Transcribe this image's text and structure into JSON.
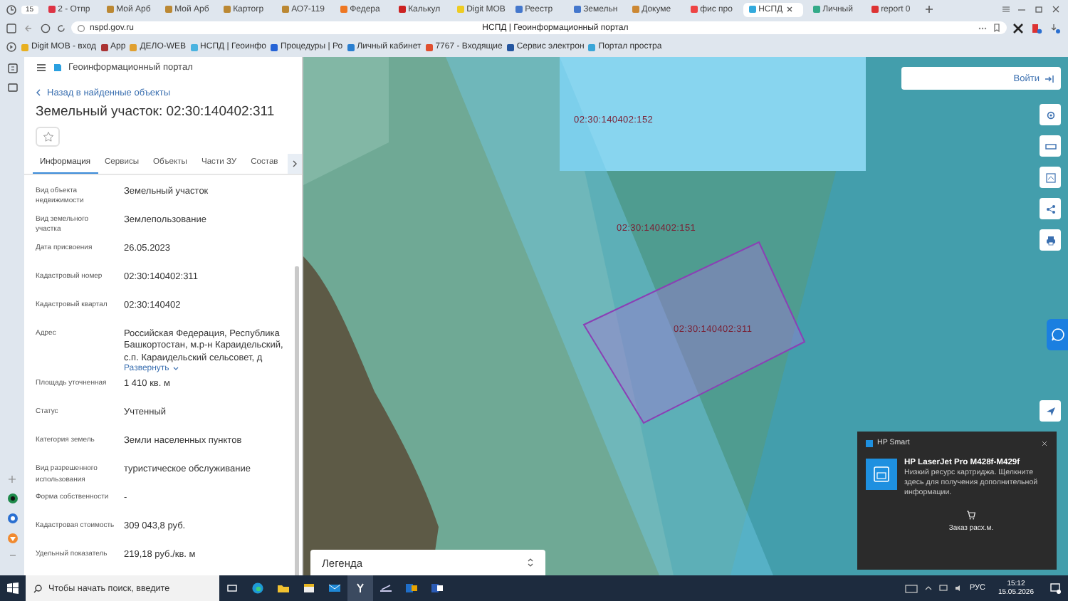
{
  "browser": {
    "tab_count": "15",
    "tabs": [
      {
        "label": "2 - Отпр",
        "selected": false
      },
      {
        "label": "Мой Арб",
        "selected": false
      },
      {
        "label": "Мой Арб",
        "selected": false
      },
      {
        "label": "Картогр",
        "selected": false
      },
      {
        "label": "АО7-119",
        "selected": false
      },
      {
        "label": "Федера",
        "selected": false
      },
      {
        "label": "Калькул",
        "selected": false
      },
      {
        "label": "Digit МОВ",
        "selected": false
      },
      {
        "label": "Реестр",
        "selected": false
      },
      {
        "label": "Земельн",
        "selected": false
      },
      {
        "label": "Докуме",
        "selected": false
      },
      {
        "label": "фис про",
        "selected": false
      },
      {
        "label": "НСПД",
        "selected": true
      },
      {
        "label": "Личный",
        "selected": false
      },
      {
        "label": "report 0",
        "selected": false
      }
    ],
    "address": "nspd.gov.ru",
    "page_title": "НСПД | Геоинформационный портал",
    "bookmarks": [
      "Digit МОВ - вход",
      "App",
      "ДЕЛО-WEB",
      "НСПД | Геоинфо",
      "Процедуры | Ро",
      "Личный кабинет",
      "7767 - Входящие",
      "Сервис электрон",
      "Портал простра"
    ]
  },
  "portal": {
    "title": "Геоинформационный портал",
    "back_link": "Назад в найденные объекты",
    "heading": "Земельный участок: 02:30:140402:311",
    "tabs": [
      {
        "label": "Информация",
        "selected": true
      },
      {
        "label": "Сервисы",
        "selected": false
      },
      {
        "label": "Объекты",
        "selected": false
      },
      {
        "label": "Части ЗУ",
        "selected": false
      },
      {
        "label": "Состав",
        "selected": false
      }
    ],
    "fields": [
      {
        "label": "Вид объекта недвижимости",
        "value": "Земельный участок"
      },
      {
        "label": "Вид земельного участка",
        "value": "Землепользование"
      },
      {
        "label": "Дата присвоения",
        "value": "26.05.2023"
      },
      {
        "label": "Кадастровый номер",
        "value": "02:30:140402:311"
      },
      {
        "label": "Кадастровый квартал",
        "value": "02:30:140402"
      },
      {
        "label": "Адрес",
        "value": "Российская Федерация, Республика Башкортостан, м.р-н Караидельский, с.п. Караидельский сельсовет, д",
        "link": "Развернуть"
      },
      {
        "label": "Площадь уточненная",
        "value": "1 410 кв. м"
      },
      {
        "label": "Статус",
        "value": "Учтенный"
      },
      {
        "label": "Категория земель",
        "value": "Земли населенных пунктов"
      },
      {
        "label": "Вид разрешенного использования",
        "value": "туристическое обслуживание"
      },
      {
        "label": "Форма собственности",
        "value": "-"
      },
      {
        "label": "Кадастровая стоимость",
        "value": "309 043,8 руб."
      },
      {
        "label": "Удельный показатель",
        "value": "219,18 руб./кв. м"
      }
    ]
  },
  "map": {
    "login_button": "Войти",
    "legend": "Легенда",
    "parcels": [
      {
        "label": "02:30:140402:152",
        "selected": false
      },
      {
        "label": "02:30:140402:151",
        "selected": false
      },
      {
        "label": "02:30:140402:311",
        "selected": true
      }
    ]
  },
  "notification": {
    "app": "HP Smart",
    "title": "HP LaserJet Pro M428f-M429f",
    "message": "Низкий ресурс картриджа. Щелкните здесь для получения дополнительной информации.",
    "action": "Заказ расх.м."
  },
  "taskbar": {
    "search_placeholder": "Чтобы начать поиск, введите",
    "language": "РУС",
    "time": "15:12",
    "date": "15.05.2026"
  }
}
